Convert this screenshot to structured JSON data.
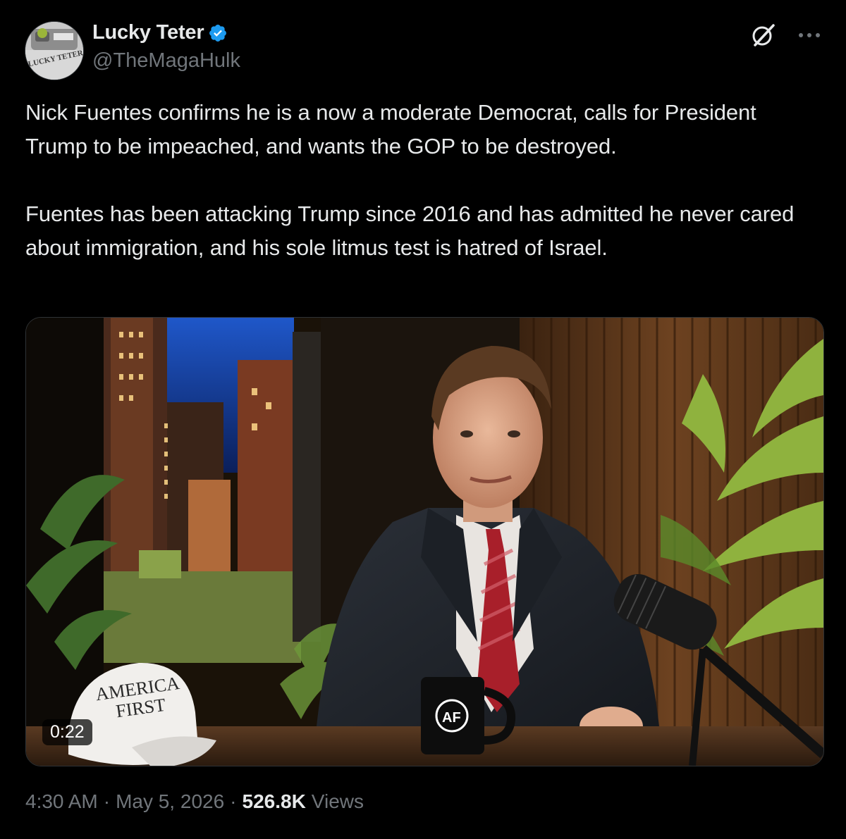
{
  "author": {
    "display_name": "Lucky Teter",
    "handle": "@TheMagaHulk",
    "verified": true,
    "avatar_text": "LUCKY TETER",
    "verified_color": "#1d9bf0"
  },
  "icons": {
    "grok": "grok-icon",
    "more": "more-icon",
    "verified": "verified-badge-icon"
  },
  "tweet": {
    "paragraphs": [
      "Nick Fuentes confirms he is a now a moderate Democrat, calls for President Trump to be impeached, and wants the GOP to be destroyed.",
      "Fuentes has been attacking Trump since 2016 and has admitted he never cared about immigration, and his sole litmus test is hatred of Israel."
    ]
  },
  "video": {
    "duration": "0:22",
    "hat_text_line1": "AMERICA",
    "hat_text_line2": "FIRST",
    "mug_text": "AF"
  },
  "meta": {
    "time": "4:30 AM",
    "separator": "·",
    "date": "May 5, 2026",
    "views_count": "526.8K",
    "views_label": "Views"
  },
  "colors": {
    "background": "#000000",
    "text_primary": "#e7e9ea",
    "text_secondary": "#71767b",
    "accent": "#1d9bf0"
  }
}
